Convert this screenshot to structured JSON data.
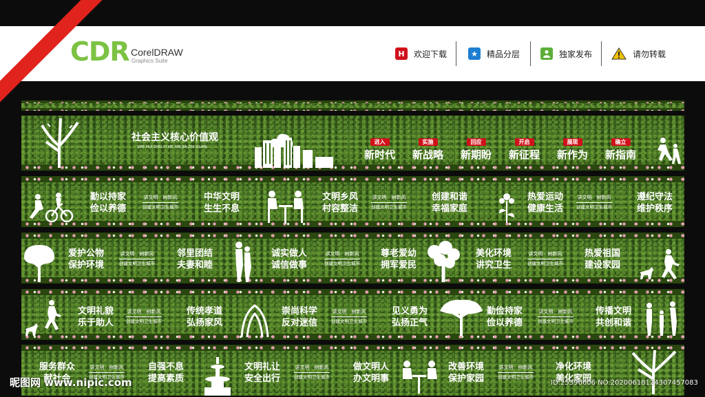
{
  "header": {
    "logo_cdr": "CDR",
    "logo_name": "CorelDRAW",
    "logo_sub": "Graphics Suite",
    "nav": [
      {
        "icon": "h-icon",
        "glyph": "H",
        "color": "#d0111a",
        "label": "欢迎下载"
      },
      {
        "icon": "star-icon",
        "glyph": "★",
        "color": "#1d7fd1",
        "label": "精品分层"
      },
      {
        "icon": "user-icon",
        "glyph": "●",
        "color": "#5cae3a",
        "label": "独家发布"
      },
      {
        "icon": "warning-icon",
        "glyph": "!",
        "color": "#f2c300",
        "label": "请勿转载"
      }
    ]
  },
  "panel1": {
    "title": "社会主义核心价值观",
    "subtitle": "SHE HUI ZHU YI HE XIN JIA ZHI GUAN",
    "tags": [
      {
        "tag": "进入",
        "text": "新时代"
      },
      {
        "tag": "实施",
        "text": "新战略"
      },
      {
        "tag": "回应",
        "text": "新期盼"
      },
      {
        "tag": "开启",
        "text": "新征程"
      },
      {
        "tag": "展现",
        "text": "新作为"
      },
      {
        "tag": "确立",
        "text": "新指南"
      }
    ]
  },
  "mini": {
    "top": "讲文明　树新风",
    "bottom": "创建文明卫生城市"
  },
  "row2": {
    "s1a": "勤以持家",
    "s1b": "俭以养德",
    "s2a": "中华文明",
    "s2b": "生生不息",
    "s3a": "文明乡风",
    "s3b": "村容整洁",
    "s4a": "创建和谐",
    "s4b": "幸福家庭",
    "s5a": "热爱运动",
    "s5b": "健康生活",
    "s6a": "遵纪守法",
    "s6b": "维护秩序"
  },
  "row3": {
    "s1a": "爱护公物",
    "s1b": "保护环境",
    "s2a": "邻里团结",
    "s2b": "夫妻和睦",
    "s3a": "诚实做人",
    "s3b": "诚信做事",
    "s4a": "尊老爱幼",
    "s4b": "拥军爱民",
    "s5a": "美化环境",
    "s5b": "讲究卫生",
    "s6a": "热爱祖国",
    "s6b": "建设家园"
  },
  "row4": {
    "s1a": "文明礼貌",
    "s1b": "乐于助人",
    "s2a": "传统孝道",
    "s2b": "弘扬家风",
    "s3a": "崇尚科学",
    "s3b": "反对迷信",
    "s4a": "见义勇为",
    "s4b": "弘扬正气",
    "s5a": "勤俭持家",
    "s5b": "俭以养德",
    "s6a": "传播文明",
    "s6b": "共创和谐"
  },
  "row5": {
    "s1a": "服务群众",
    "s1b": "献社会",
    "s2a": "自强不息",
    "s2b": "提高素质",
    "s3a": "文明礼让",
    "s3b": "安全出行",
    "s4a": "做文明人",
    "s4b": "办文明事",
    "s5a": "改善环境",
    "s5b": "保护家园",
    "s6a": "净化环境",
    "s6b": "美化家园"
  },
  "watermark": {
    "left": "昵图网 www.nipic.com",
    "right": "ID:25396606 NO:20200618124307457083"
  }
}
